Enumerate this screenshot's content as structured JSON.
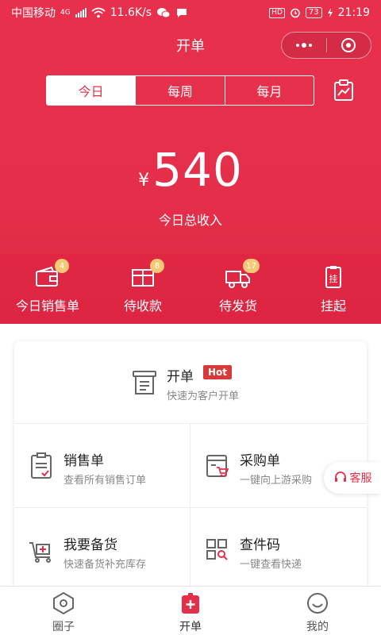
{
  "status_bar": {
    "carrier": "中国移动",
    "network": "4G",
    "speed": "11.6K/s",
    "hd": "HD",
    "battery": "73",
    "time": "21:19"
  },
  "nav": {
    "title": "开单"
  },
  "period_tabs": [
    {
      "label": "今日",
      "active": true
    },
    {
      "label": "每周",
      "active": false
    },
    {
      "label": "每月",
      "active": false
    }
  ],
  "summary": {
    "currency": "¥",
    "amount": "540",
    "label": "今日总收入"
  },
  "quick_actions": [
    {
      "label": "今日销售单",
      "badge": "4",
      "icon": "wallet-icon"
    },
    {
      "label": "待收款",
      "badge": "8",
      "icon": "box-icon"
    },
    {
      "label": "待发货",
      "badge": "17",
      "icon": "truck-icon"
    },
    {
      "label": "挂起",
      "badge": "",
      "icon": "pending-clipboard-icon"
    }
  ],
  "main_card": {
    "open_order": {
      "title": "开单",
      "hot": "Hot",
      "subtitle": "快速为客户开单"
    },
    "items": [
      {
        "title": "销售单",
        "subtitle": "查看所有销售订单",
        "icon": "sales-order-icon"
      },
      {
        "title": "采购单",
        "subtitle": "一键向上游采购",
        "icon": "purchase-order-icon"
      },
      {
        "title": "我要备货",
        "subtitle": "快速备货补充库存",
        "icon": "stock-cart-icon"
      },
      {
        "title": "查件码",
        "subtitle": "一键查看快递",
        "icon": "qr-search-icon"
      }
    ]
  },
  "customer_service": {
    "label": "客服"
  },
  "tabbar": [
    {
      "label": "圈子",
      "active": false,
      "icon": "circle-hex-icon"
    },
    {
      "label": "开单",
      "active": true,
      "icon": "plus-bag-icon"
    },
    {
      "label": "我的",
      "active": false,
      "icon": "smile-icon"
    }
  ],
  "colors": {
    "brand": "#e52f4a",
    "badge": "#f5c873",
    "hot": "#d83a3a"
  }
}
